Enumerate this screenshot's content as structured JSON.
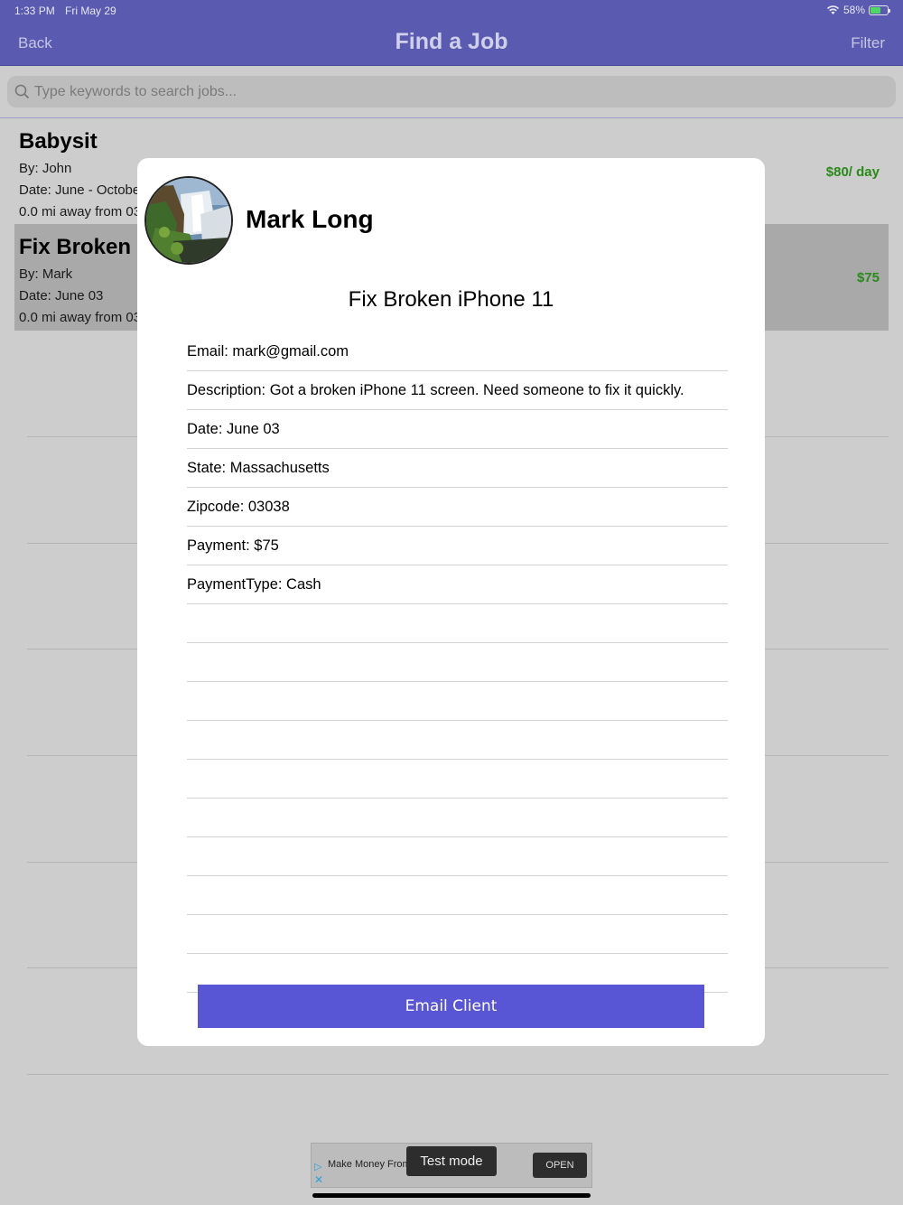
{
  "status": {
    "time": "1:33 PM",
    "date": "Fri May 29",
    "battery": "58%"
  },
  "nav": {
    "back": "Back",
    "title": "Find a Job",
    "filter": "Filter"
  },
  "search": {
    "placeholder": "Type keywords to search jobs..."
  },
  "jobs": [
    {
      "title": "Babysit",
      "by": "By: John",
      "date": "Date: June - Octobe",
      "distance": "0.0 mi away from 03",
      "price": "$80/ day"
    },
    {
      "title": "Fix Broken i",
      "by": "By: Mark",
      "date": "Date: June 03",
      "distance": "0.0 mi away from 03",
      "price": "$75"
    }
  ],
  "modal": {
    "name": "Mark Long",
    "job_title": "Fix Broken iPhone 11",
    "details": [
      "Email: mark@gmail.com",
      "Description: Got a broken iPhone 11 screen. Need someone to fix it quickly.",
      "Date: June 03",
      "State: Massachusetts",
      "Zipcode: 03038",
      "Payment: $75",
      "PaymentType: Cash",
      "",
      "",
      "",
      "",
      "",
      "",
      "",
      "",
      "",
      ""
    ],
    "button": "Email Client"
  },
  "ad": {
    "text": "Make Money From",
    "test": "Test mode",
    "open": "OPEN"
  },
  "colors": {
    "nav_bg": "#5a5bb0",
    "button_bg": "#5956d6",
    "price_green": "#2a8a1a"
  }
}
